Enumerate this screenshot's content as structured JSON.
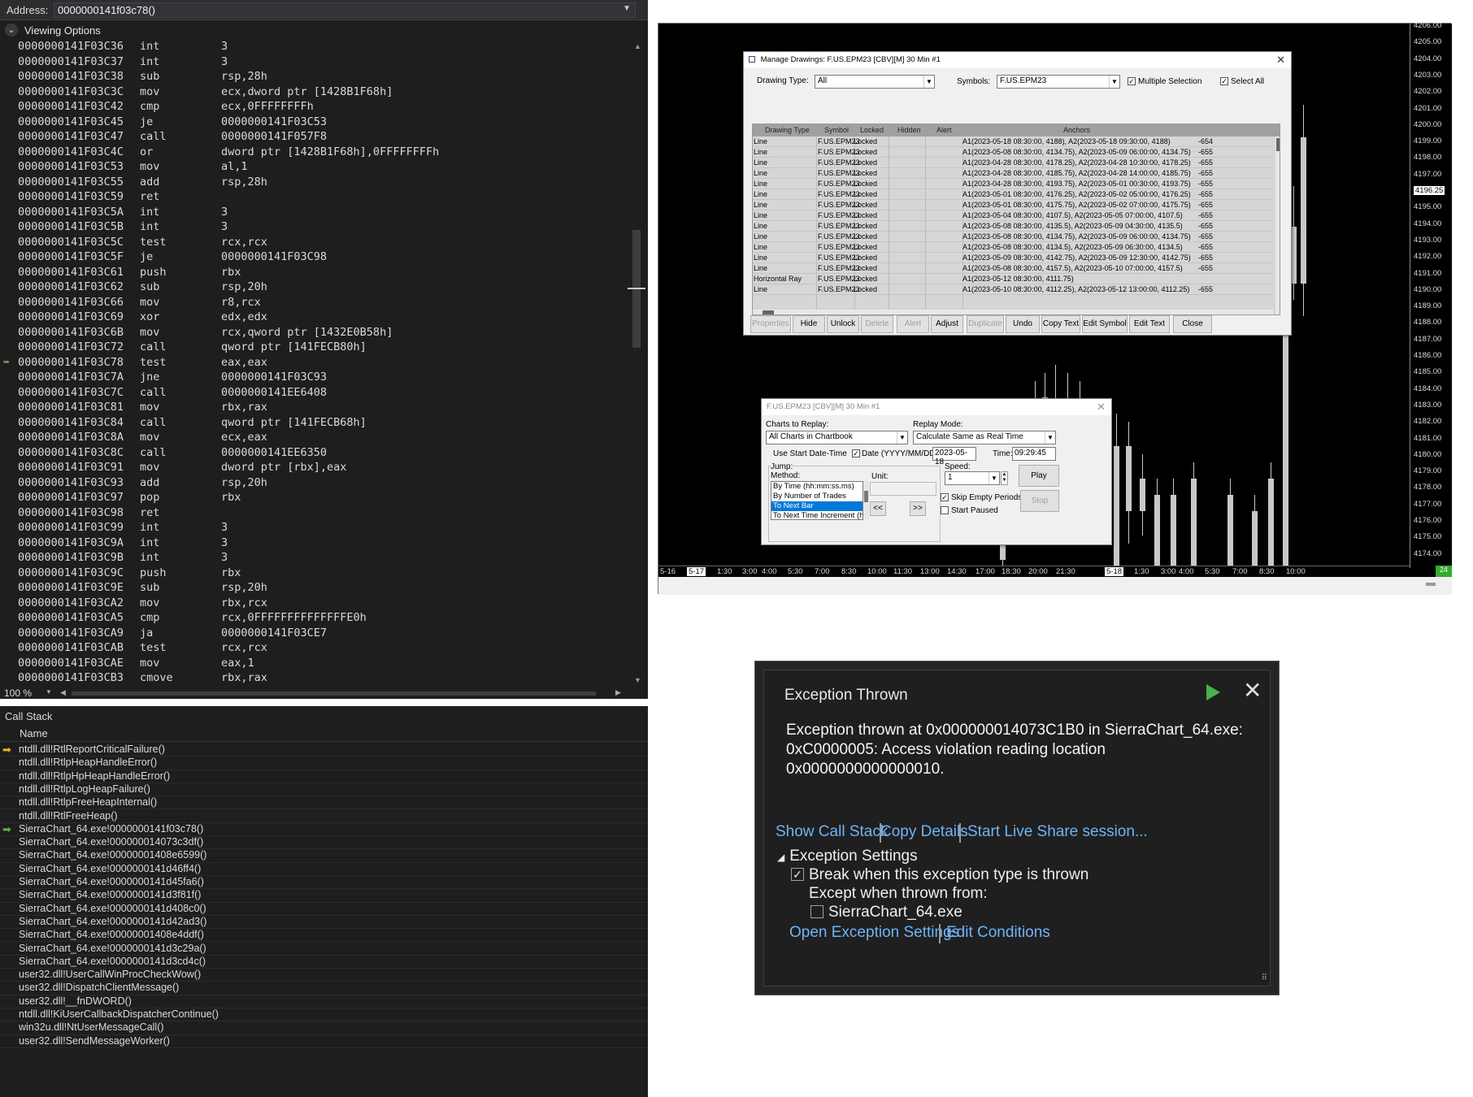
{
  "disasm": {
    "address_label": "Address:",
    "address_value": "0000000141f03c78()",
    "viewing_options": "Viewing Options",
    "zoom": "100 %",
    "lines": [
      {
        "a": "0000000141F03C36",
        "m": "int",
        "o": "3"
      },
      {
        "a": "0000000141F03C37",
        "m": "int",
        "o": "3"
      },
      {
        "a": "0000000141F03C38",
        "m": "sub",
        "o": "rsp,28h"
      },
      {
        "a": "0000000141F03C3C",
        "m": "mov",
        "o": "ecx,dword ptr [1428B1F68h]"
      },
      {
        "a": "0000000141F03C42",
        "m": "cmp",
        "o": "ecx,0FFFFFFFFh"
      },
      {
        "a": "0000000141F03C45",
        "m": "je",
        "o": "0000000141F03C53"
      },
      {
        "a": "0000000141F03C47",
        "m": "call",
        "o": "0000000141F057F8"
      },
      {
        "a": "0000000141F03C4C",
        "m": "or",
        "o": "dword ptr [1428B1F68h],0FFFFFFFFh"
      },
      {
        "a": "0000000141F03C53",
        "m": "mov",
        "o": "al,1"
      },
      {
        "a": "0000000141F03C55",
        "m": "add",
        "o": "rsp,28h"
      },
      {
        "a": "0000000141F03C59",
        "m": "ret",
        "o": ""
      },
      {
        "a": "0000000141F03C5A",
        "m": "int",
        "o": "3"
      },
      {
        "a": "0000000141F03C5B",
        "m": "int",
        "o": "3"
      },
      {
        "a": "0000000141F03C5C",
        "m": "test",
        "o": "rcx,rcx"
      },
      {
        "a": "0000000141F03C5F",
        "m": "je",
        "o": "0000000141F03C98"
      },
      {
        "a": "0000000141F03C61",
        "m": "push",
        "o": "rbx"
      },
      {
        "a": "0000000141F03C62",
        "m": "sub",
        "o": "rsp,20h"
      },
      {
        "a": "0000000141F03C66",
        "m": "mov",
        "o": "r8,rcx"
      },
      {
        "a": "0000000141F03C69",
        "m": "xor",
        "o": "edx,edx"
      },
      {
        "a": "0000000141F03C6B",
        "m": "mov",
        "o": "rcx,qword ptr [1432E0B58h]"
      },
      {
        "a": "0000000141F03C72",
        "m": "call",
        "o": "qword ptr [141FECB80h]"
      },
      {
        "a": "0000000141F03C78",
        "m": "test",
        "o": "eax,eax",
        "cur": true
      },
      {
        "a": "0000000141F03C7A",
        "m": "jne",
        "o": "0000000141F03C93"
      },
      {
        "a": "0000000141F03C7C",
        "m": "call",
        "o": "0000000141EE6408"
      },
      {
        "a": "0000000141F03C81",
        "m": "mov",
        "o": "rbx,rax"
      },
      {
        "a": "0000000141F03C84",
        "m": "call",
        "o": "qword ptr [141FECB68h]"
      },
      {
        "a": "0000000141F03C8A",
        "m": "mov",
        "o": "ecx,eax"
      },
      {
        "a": "0000000141F03C8C",
        "m": "call",
        "o": "0000000141EE6350"
      },
      {
        "a": "0000000141F03C91",
        "m": "mov",
        "o": "dword ptr [rbx],eax"
      },
      {
        "a": "0000000141F03C93",
        "m": "add",
        "o": "rsp,20h"
      },
      {
        "a": "0000000141F03C97",
        "m": "pop",
        "o": "rbx"
      },
      {
        "a": "0000000141F03C98",
        "m": "ret",
        "o": ""
      },
      {
        "a": "0000000141F03C99",
        "m": "int",
        "o": "3"
      },
      {
        "a": "0000000141F03C9A",
        "m": "int",
        "o": "3"
      },
      {
        "a": "0000000141F03C9B",
        "m": "int",
        "o": "3"
      },
      {
        "a": "0000000141F03C9C",
        "m": "push",
        "o": "rbx"
      },
      {
        "a": "0000000141F03C9E",
        "m": "sub",
        "o": "rsp,20h"
      },
      {
        "a": "0000000141F03CA2",
        "m": "mov",
        "o": "rbx,rcx"
      },
      {
        "a": "0000000141F03CA5",
        "m": "cmp",
        "o": "rcx,0FFFFFFFFFFFFFFE0h"
      },
      {
        "a": "0000000141F03CA9",
        "m": "ja",
        "o": "0000000141F03CE7"
      },
      {
        "a": "0000000141F03CAB",
        "m": "test",
        "o": "rcx,rcx"
      },
      {
        "a": "0000000141F03CAE",
        "m": "mov",
        "o": "eax,1"
      },
      {
        "a": "0000000141F03CB3",
        "m": "cmove",
        "o": "rbx,rax"
      }
    ]
  },
  "callstack": {
    "title": "Call Stack",
    "col_name": "Name",
    "frames": [
      {
        "n": "ntdll.dll!RtlReportCriticalFailure()",
        "ic": "yel"
      },
      {
        "n": "ntdll.dll!RtlpHeapHandleError()"
      },
      {
        "n": "ntdll.dll!RtlpHpHeapHandleError()"
      },
      {
        "n": "ntdll.dll!RtlpLogHeapFailure()"
      },
      {
        "n": "ntdll.dll!RtlpFreeHeapInternal()"
      },
      {
        "n": "ntdll.dll!RtlFreeHeap()"
      },
      {
        "n": "SierraChart_64.exe!0000000141f03c78()",
        "ic": "grn"
      },
      {
        "n": "SierraChart_64.exe!000000014073c3df()"
      },
      {
        "n": "SierraChart_64.exe!00000001408e6599()"
      },
      {
        "n": "SierraChart_64.exe!0000000141d46ff4()"
      },
      {
        "n": "SierraChart_64.exe!0000000141d45fa6()"
      },
      {
        "n": "SierraChart_64.exe!0000000141d3f81f()"
      },
      {
        "n": "SierraChart_64.exe!0000000141d408c0()"
      },
      {
        "n": "SierraChart_64.exe!0000000141d42ad3()"
      },
      {
        "n": "SierraChart_64.exe!00000001408e4ddf()"
      },
      {
        "n": "SierraChart_64.exe!0000000141d3c29a()"
      },
      {
        "n": "SierraChart_64.exe!0000000141d3cd4c()"
      },
      {
        "n": "user32.dll!UserCallWinProcCheckWow()"
      },
      {
        "n": "user32.dll!DispatchClientMessage()"
      },
      {
        "n": "user32.dll!__fnDWORD()"
      },
      {
        "n": "ntdll.dll!KiUserCallbackDispatcherContinue()"
      },
      {
        "n": "win32u.dll!NtUserMessageCall()"
      },
      {
        "n": "user32.dll!SendMessageWorker()"
      }
    ]
  },
  "chart": {
    "price_labels": [
      "4206.00",
      "4205.00",
      "4204.00",
      "4203.00",
      "4202.00",
      "4201.00",
      "4200.00",
      "4199.00",
      "4198.00",
      "4197.00",
      "4196.25",
      "4195.00",
      "4194.00",
      "4193.00",
      "4192.00",
      "4191.00",
      "4190.00",
      "4189.00",
      "4188.00",
      "4187.00",
      "4186.00",
      "4185.00",
      "4184.00",
      "4183.00",
      "4182.00",
      "4181.00",
      "4180.00",
      "4179.00",
      "4178.00",
      "4177.00",
      "4176.00",
      "4175.00",
      "4174.00"
    ],
    "current_price": "4196.25",
    "time_labels": [
      "5-16",
      "5-17",
      "1:30",
      "3:00",
      "4:00",
      "5:30",
      "7:00",
      "8:30",
      "10:00",
      "11:30",
      "13:00",
      "14:30",
      "17:00",
      "18:30",
      "20:00",
      "21:30",
      "5-18",
      "1:30",
      "3:00",
      "4:00",
      "5:30",
      "7:00",
      "8:30",
      "10:00"
    ],
    "corner_badge": "24"
  },
  "manage": {
    "title": "Manage Drawings: F.US.EPM23 [CBV][M]  30 Min  #1",
    "drawing_type_label": "Drawing Type:",
    "drawing_type_value": "All",
    "symbols_label": "Symbols:",
    "symbols_value": "F.US.EPM23",
    "multiple_selection": "Multiple Selection",
    "select_all": "Select All",
    "columns": [
      "Drawing Type",
      "Symbol",
      "Locked",
      "Hidden",
      "Alert",
      "Anchors"
    ],
    "rows": [
      {
        "t": "Line",
        "s": "F.US.EPM23",
        "l": "Locked",
        "a": "A1(2023-05-18  08:30:00, 4188), A2(2023-05-18  09:30:00, 4188)",
        "x": "-654"
      },
      {
        "t": "Line",
        "s": "F.US.EPM23",
        "l": "Locked",
        "a": "A1(2023-05-08  08:30:00, 4134.75), A2(2023-05-09  06:00:00, 4134.75)",
        "x": "-655"
      },
      {
        "t": "Line",
        "s": "F.US.EPM23",
        "l": "Locked",
        "a": "A1(2023-04-28  08:30:00, 4178.25), A2(2023-04-28  10:30:00, 4178.25)",
        "x": "-655"
      },
      {
        "t": "Line",
        "s": "F.US.EPM23",
        "l": "Locked",
        "a": "A1(2023-04-28  08:30:00, 4185.75), A2(2023-04-28  14:00:00, 4185.75)",
        "x": "-655"
      },
      {
        "t": "Line",
        "s": "F.US.EPM23",
        "l": "Locked",
        "a": "A1(2023-04-28  08:30:00, 4193.75), A2(2023-05-01  00:30:00, 4193.75)",
        "x": "-655"
      },
      {
        "t": "Line",
        "s": "F.US.EPM23",
        "l": "Locked",
        "a": "A1(2023-05-01  08:30:00, 4176.25), A2(2023-05-02  05:00:00, 4176.25)",
        "x": "-655"
      },
      {
        "t": "Line",
        "s": "F.US.EPM23",
        "l": "Locked",
        "a": "A1(2023-05-01  08:30:00, 4175.75), A2(2023-05-02  07:00:00, 4175.75)",
        "x": "-655"
      },
      {
        "t": "Line",
        "s": "F.US.EPM23",
        "l": "Locked",
        "a": "A1(2023-05-04  08:30:00, 4107.5), A2(2023-05-05  07:00:00, 4107.5)",
        "x": "-655"
      },
      {
        "t": "Line",
        "s": "F.US.EPM23",
        "l": "Locked",
        "a": "A1(2023-05-08  08:30:00, 4135.5), A2(2023-05-09  04:30:00, 4135.5)",
        "x": "-655"
      },
      {
        "t": "Line",
        "s": "F.US.EPM23",
        "l": "Locked",
        "a": "A1(2023-05-08  08:30:00, 4134.75), A2(2023-05-09  06:00:00, 4134.75)",
        "x": "-655"
      },
      {
        "t": "Line",
        "s": "F.US.EPM23",
        "l": "Locked",
        "a": "A1(2023-05-08  08:30:00, 4134.5), A2(2023-05-09  06:30:00, 4134.5)",
        "x": "-655"
      },
      {
        "t": "Line",
        "s": "F.US.EPM23",
        "l": "Locked",
        "a": "A1(2023-05-09  08:30:00, 4142.75), A2(2023-05-09  12:30:00, 4142.75)",
        "x": "-655"
      },
      {
        "t": "Line",
        "s": "F.US.EPM23",
        "l": "Locked",
        "a": "A1(2023-05-08  08:30:00, 4157.5), A2(2023-05-10  07:00:00, 4157.5)",
        "x": "-655"
      },
      {
        "t": "Horizontal Ray",
        "s": "F.US.EPM23",
        "l": "Locked",
        "a": "A1(2023-05-12  08:30:00, 4111.75)",
        "x": ""
      },
      {
        "t": "Line",
        "s": "F.US.EPM23",
        "l": "Locked",
        "a": "A1(2023-05-10  08:30:00, 4112.25), A2(2023-05-12  13:00:00, 4112.25)",
        "x": "-655"
      }
    ],
    "buttons": [
      {
        "label": "Properties",
        "dis": true
      },
      {
        "label": "Hide"
      },
      {
        "label": "Unlock"
      },
      {
        "label": "Delete",
        "dis": true
      },
      {
        "label": "Alert",
        "dis": true
      },
      {
        "label": "Adjust"
      },
      {
        "label": "Duplicate",
        "dis": true
      },
      {
        "label": "Undo"
      },
      {
        "label": "Copy Text"
      },
      {
        "label": "Edit Symbol"
      },
      {
        "label": "Edit Text"
      },
      {
        "label": "Close"
      }
    ]
  },
  "replay": {
    "title": "F.US.EPM23 [CBV][M]  30 Min  #1",
    "charts_label": "Charts to Replay:",
    "charts_value": "All Charts in Chartbook",
    "mode_label": "Replay Mode:",
    "mode_value": "Calculate Same as Real Time",
    "use_start": "Use Start Date-Time",
    "date_label": "Date (YYYY/MM/DD):",
    "date_value": "2023-05-18",
    "time_label": "Time:",
    "time_value": "09:29:45",
    "jump_label": "Jump:",
    "method_label": "Method:",
    "methods": [
      "By Time (hh:mm:ss.ms)",
      "By Number of Trades",
      "To Next Bar",
      "To Next Time Increment (h"
    ],
    "unit_label": "Unit:",
    "prev": "<<",
    "next": ">>",
    "speed_label": "Speed:",
    "speed_value": "1",
    "play": "Play",
    "stop": "Stop",
    "skip_empty": "Skip Empty Periods",
    "start_paused": "Start Paused"
  },
  "exception": {
    "title": "Exception Thrown",
    "message_line1": "Exception thrown at 0x000000014073C1B0 in SierraChart_64.exe:",
    "message_line2": "0xC0000005: Access violation reading location 0x0000000000000010.",
    "show_call_stack": "Show Call Stack",
    "copy_details": "Copy Details",
    "live_share": "Start Live Share session...",
    "settings_header": "Exception Settings",
    "break_when": "Break when this exception type is thrown",
    "except_when": "Except when thrown from:",
    "except_module": "SierraChart_64.exe",
    "open_settings": "Open Exception Settings",
    "edit_conditions": "Edit Conditions"
  }
}
